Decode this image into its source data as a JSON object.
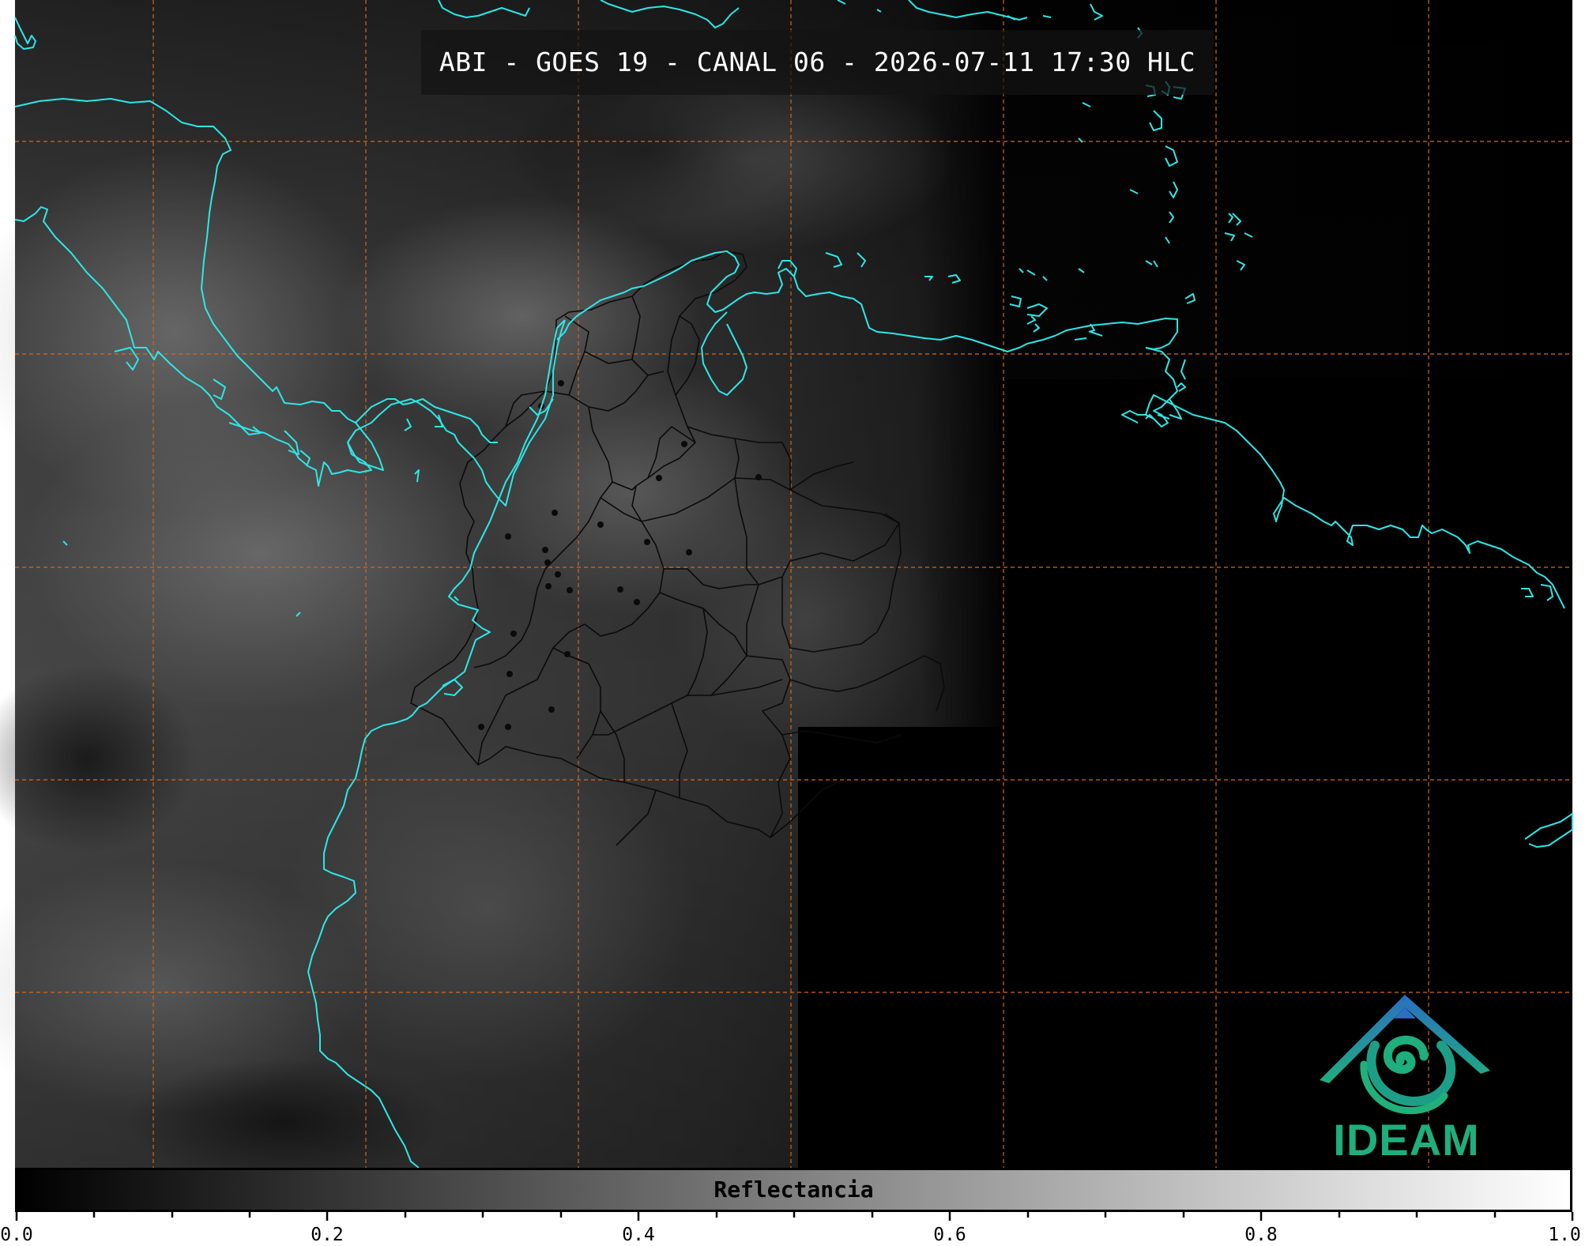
{
  "title": "ABI - GOES 19 - CANAL 06 - 2026-07-11 17:30 HLC",
  "colorbar": {
    "label": "Reflectancia",
    "ticks": [
      "0.0",
      "0.2",
      "0.4",
      "0.6",
      "0.8",
      "1.0"
    ],
    "min": 0.0,
    "max": 1.0,
    "colormap": [
      "#000000",
      "#ffffff"
    ]
  },
  "logo": {
    "text": "IDEAM",
    "colors": {
      "primary": "#1fae7e",
      "secondary": "#2a7fc0"
    }
  },
  "colors": {
    "coastline": "#2ee6e6",
    "gridlines": "#d2691e",
    "borders": "#0a0a0a",
    "night_background": "#000000"
  }
}
